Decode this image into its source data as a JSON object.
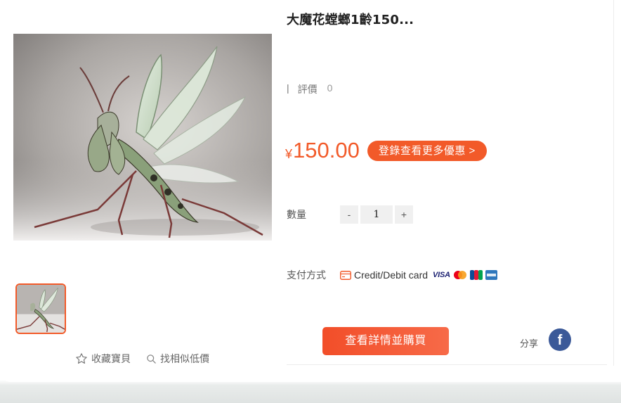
{
  "product": {
    "title": "大魔花螳螂1齡150...",
    "rating_separator": "|",
    "rating_label": "評價",
    "rating_count": "0",
    "currency_symbol": "¥",
    "price": "150.00",
    "promo_button": "登錄查看更多優惠 >",
    "quantity_label": "數量",
    "quantity_minus": "-",
    "quantity_value": "1",
    "quantity_plus": "+",
    "payment_label": "支付方式",
    "payment_method": "Credit/Debit card",
    "card_brands": [
      "VISA",
      "mastercard-icon",
      "jcb-icon",
      "amex-icon"
    ],
    "buy_button": "查看詳情並購買",
    "share_label": "分享"
  },
  "gallery": {
    "favorite_label": "收藏寶貝",
    "find_similar_label": "找相似低價"
  },
  "colors": {
    "accent": "#f25a29",
    "facebook": "#3b5998"
  }
}
